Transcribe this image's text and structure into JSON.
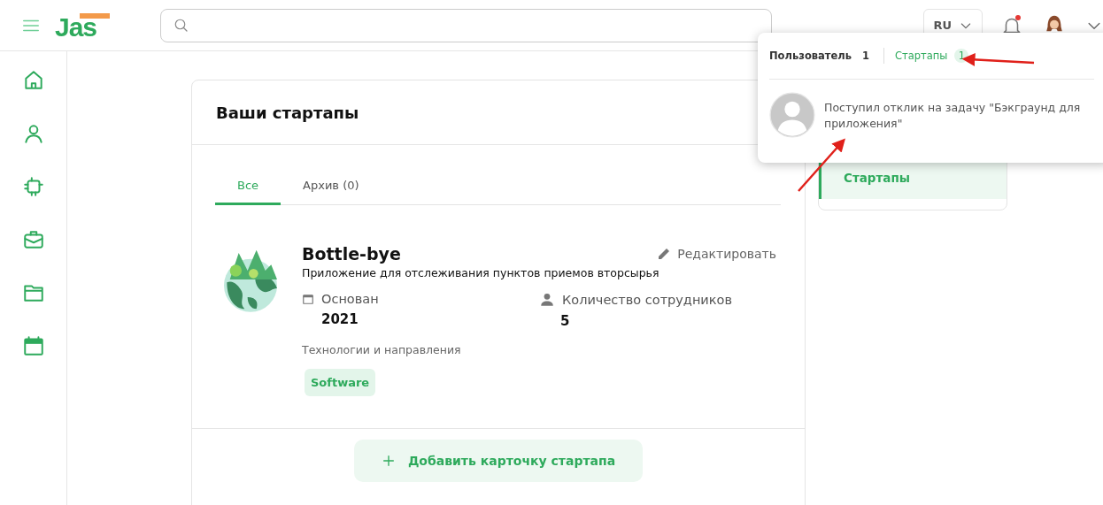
{
  "header": {
    "logo": "Jas",
    "language": "RU",
    "has_unread": true
  },
  "page": {
    "title": "Ваши стартапы",
    "tabs": [
      {
        "label": "Все",
        "selected": true
      },
      {
        "label": "Архив (0)",
        "selected": false
      }
    ],
    "startup": {
      "name": "Bottle-bye",
      "description": "Приложение для отслеживания пунктов приемов вторсырья",
      "edit_label": "Редактировать",
      "founded_label": "Основан",
      "founded_value": "2021",
      "employees_label": "Количество сотрудников",
      "employees_value": "5",
      "tags_label": "Технологии и направления",
      "tags": [
        "Software"
      ]
    },
    "add_button": "Добавить карточку стартапа"
  },
  "right_panel": {
    "items": [
      {
        "label": "Стартапы",
        "selected": true
      }
    ]
  },
  "notifications": {
    "tabs": [
      {
        "label": "Пользователь",
        "count": "1",
        "selected": false
      },
      {
        "label": "Стартапы",
        "count": "1",
        "selected": true
      }
    ],
    "items": [
      {
        "text": "Поступил отклик на задачу \"Бэкграунд для приложения\""
      }
    ]
  }
}
